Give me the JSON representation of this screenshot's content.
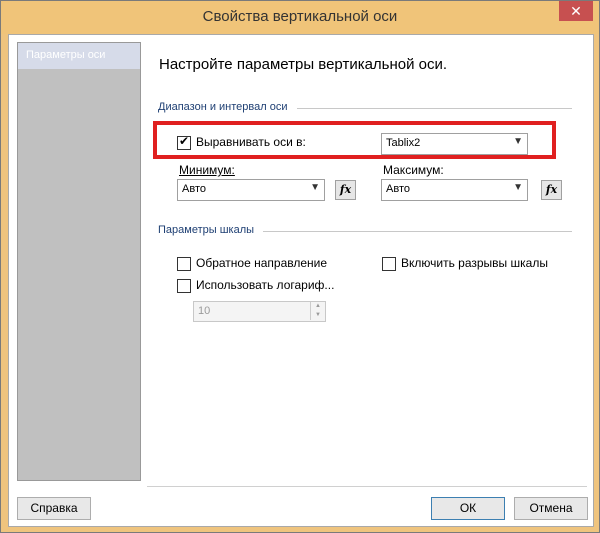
{
  "window": {
    "title": "Свойства вертикальной оси",
    "close_glyph": "✕"
  },
  "sidebar": {
    "items": [
      {
        "label": "Параметры оси",
        "selected": true
      }
    ]
  },
  "main": {
    "heading": "Настройте параметры вертикальной оси.",
    "range_group": {
      "title": "Диапазон и интервал оси",
      "align_checkbox": {
        "label": "Выравнивать оси в:",
        "checked": true
      },
      "align_select": {
        "value": "Tablix2"
      },
      "minimum": {
        "label": "Минимум:",
        "value": "Авто"
      },
      "maximum": {
        "label": "Максимум:",
        "value": "Авто"
      },
      "fx_label": "fx"
    },
    "scale_group": {
      "title": "Параметры шкалы",
      "reverse": {
        "label": "Обратное направление",
        "checked": false
      },
      "breaks": {
        "label": "Включить разрывы шкалы",
        "checked": false
      },
      "log": {
        "label": "Использовать логариф...",
        "checked": false
      },
      "log_base": {
        "value": "10"
      }
    }
  },
  "footer": {
    "help_label": "Справка",
    "ok_label": "ОК",
    "cancel_label": "Отмена"
  },
  "colors": {
    "accent_frame": "#f0c479",
    "highlight_box": "#e02020",
    "close_button": "#c75050",
    "group_title": "#1e3f73"
  }
}
